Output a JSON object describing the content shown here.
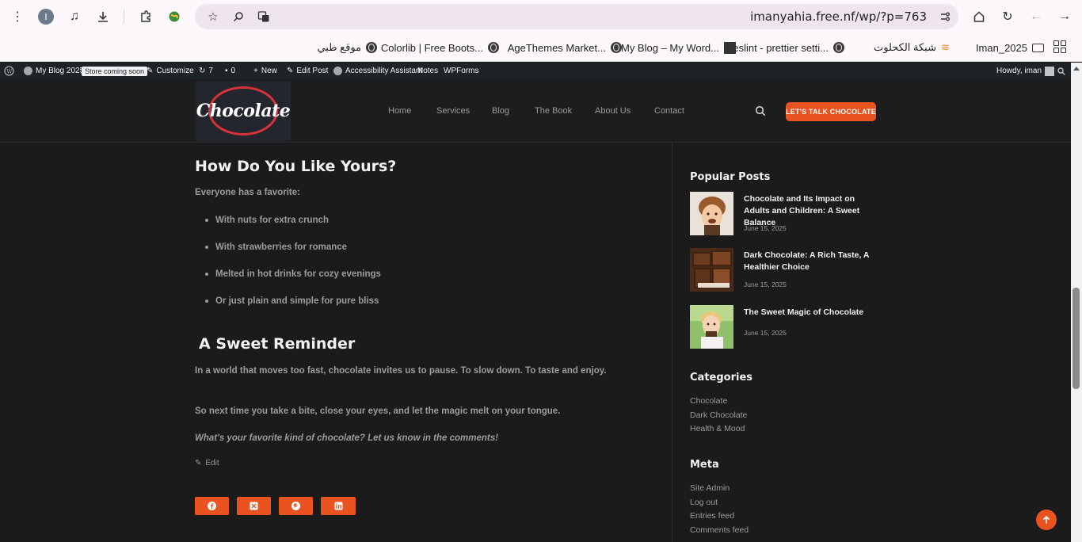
{
  "browser": {
    "profile_initial": "I",
    "url": "imanyahia.free.nf/wp/?p=763",
    "bookmarks": [
      {
        "label": "Iman_2025",
        "icon": "folder-icon"
      },
      {
        "label": "شبكة الكحلوت",
        "icon": "stack-icon"
      },
      {
        "label": "eslint - prettier setti...",
        "icon": "globe-icon"
      },
      {
        "label": "My Blog – My Word...",
        "icon": "agethemes-icon"
      },
      {
        "label": "AgeThemes Market...",
        "icon": "globe-icon"
      },
      {
        "label": "Colorlib | Free Boots...",
        "icon": "globe-icon"
      },
      {
        "label": "موقع طبي",
        "icon": "globe-icon"
      }
    ]
  },
  "adminbar": {
    "site_name": "My Blog 2025",
    "badge": "Store coming soon",
    "customize": "Customize",
    "updates_count": "7",
    "comments_count": "0",
    "new": "New",
    "edit_post": "Edit Post",
    "accessibility": "Accessibility Assistant",
    "notes": "Notes",
    "wpforms": "WPForms",
    "howdy": "Howdy, iman"
  },
  "header": {
    "logo_text": "Chocolate",
    "nav": [
      "Home",
      "Services",
      "Blog",
      "The Book",
      "About Us",
      "Contact"
    ],
    "cta": "LET'S TALK CHOCOLATE"
  },
  "article": {
    "heading1": "How Do You Like Yours?",
    "intro": "Everyone has a favorite:",
    "bullets": [
      "With nuts for extra crunch",
      "With strawberries for romance",
      "Melted in hot drinks for cozy evenings",
      "Or just plain and simple for pure bliss"
    ],
    "heading2": "A Sweet Reminder",
    "para1": "In a world that moves too fast, chocolate invites us to pause. To slow down. To taste and enjoy.",
    "para2": "So next time you take a bite, close your eyes, and let the magic melt on your tongue.",
    "question": "What's your favorite kind of chocolate? Let us know in the comments!",
    "edit": "Edit",
    "share_icons": [
      "facebook-icon",
      "x-icon",
      "pinterest-icon",
      "linkedin-icon"
    ]
  },
  "sidebar": {
    "popular_title": "Popular Posts",
    "posts": [
      {
        "title": "Chocolate and Its Impact on Adults and Children: A Sweet Balance",
        "date": "June 15, 2025"
      },
      {
        "title": "Dark Chocolate: A Rich Taste, A Healthier Choice",
        "date": "June 15, 2025"
      },
      {
        "title": "The Sweet Magic of Chocolate",
        "date": "June 15, 2025"
      }
    ],
    "categories_title": "Categories",
    "categories": [
      "Chocolate",
      "Dark Chocolate",
      "Health & Mood"
    ],
    "meta_title": "Meta",
    "meta_links": [
      "Site Admin",
      "Log out",
      "Entries feed",
      "Comments feed"
    ]
  },
  "colors": {
    "accent": "#e9531f",
    "background": "#1b1b1b",
    "adminbar": "#1d2327"
  }
}
